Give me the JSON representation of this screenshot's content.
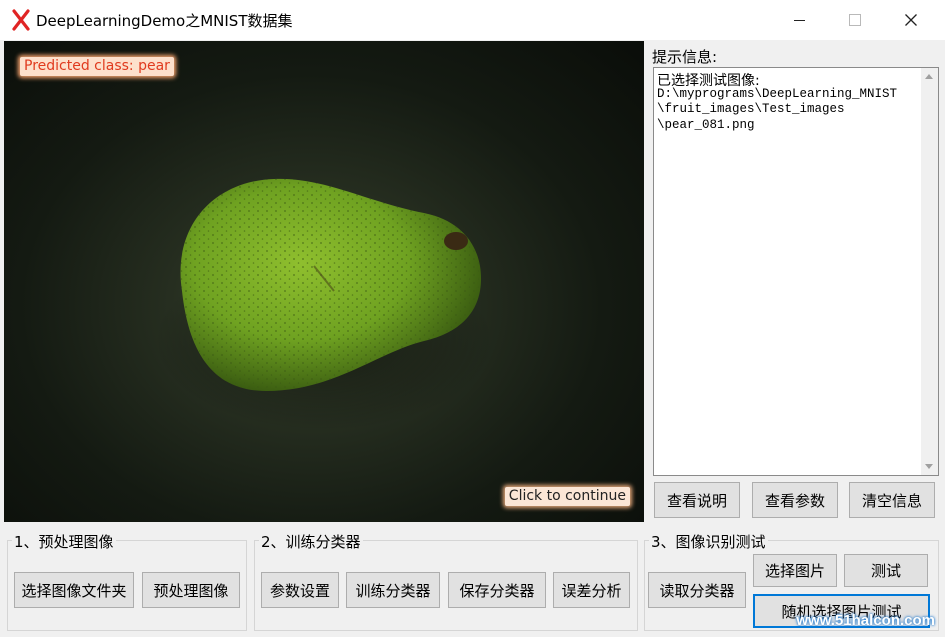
{
  "window": {
    "title": "DeepLearningDemo之MNIST数据集",
    "icon": "red-x-app-icon"
  },
  "viewer": {
    "predicted_label": "Predicted class: pear",
    "continue_label": "Click to continue",
    "image_subject": "pear"
  },
  "info": {
    "label": "提示信息:",
    "heading": "已选择测试图像:",
    "lines": [
      "D:\\myprograms\\DeepLearning_MNIST",
      "\\fruit_images\\Test_images",
      "\\pear_081.png"
    ]
  },
  "info_buttons": {
    "view_help": "查看说明",
    "view_params": "查看参数",
    "clear_info": "清空信息"
  },
  "group1": {
    "title": "1、预处理图像",
    "select_folder": "选择图像文件夹",
    "preprocess": "预处理图像"
  },
  "group2": {
    "title": "2、训练分类器",
    "param_settings": "参数设置",
    "train": "训练分类器",
    "save": "保存分类器",
    "error_analysis": "误差分析"
  },
  "group3": {
    "title": "3、图像识别测试",
    "read_classifier": "读取分类器",
    "select_image": "选择图片",
    "test": "测试",
    "random_test": "随机选择图片测试"
  },
  "watermark": "www.51halcon.com",
  "colors": {
    "accent_focus": "#0078d7",
    "predicted_text": "#e03a1e",
    "button_face": "#e1e1e1"
  }
}
